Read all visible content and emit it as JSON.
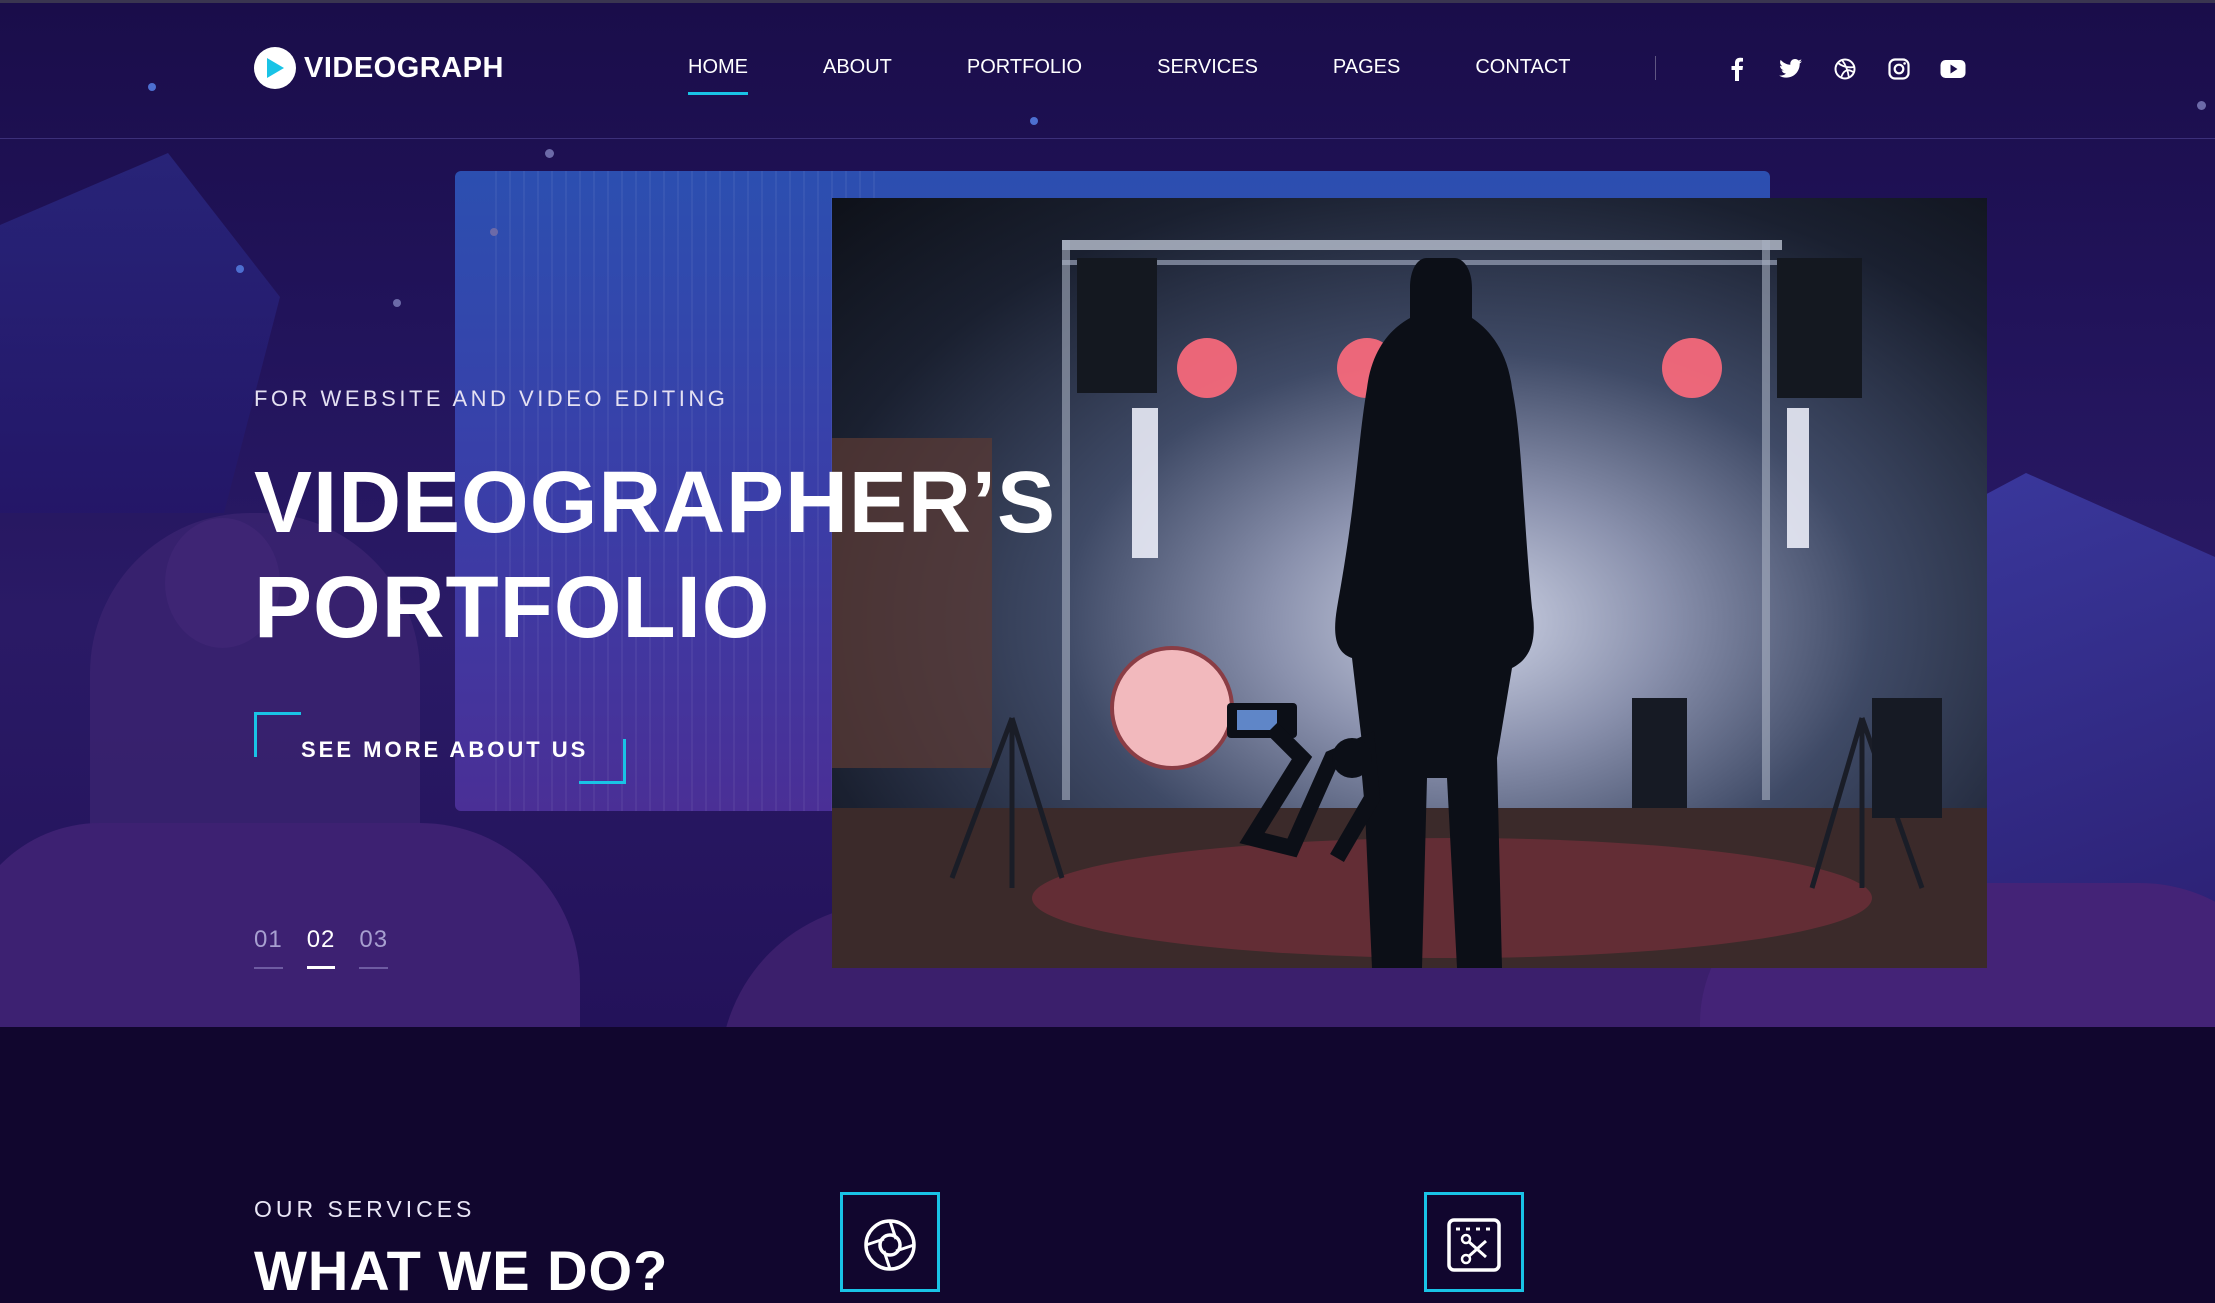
{
  "brand": {
    "name": "VIDEOGRAPH"
  },
  "nav": {
    "items": [
      {
        "label": "HOME",
        "active": true
      },
      {
        "label": "ABOUT"
      },
      {
        "label": "PORTFOLIO"
      },
      {
        "label": "SERVICES"
      },
      {
        "label": "PAGES"
      },
      {
        "label": "CONTACT"
      }
    ]
  },
  "social": [
    "facebook-icon",
    "twitter-icon",
    "dribbble-icon",
    "instagram-icon",
    "youtube-icon"
  ],
  "hero": {
    "eyebrow": "FOR WEBSITE AND VIDEO EDITING",
    "title_line1": "VIDEOGRAPHER’S",
    "title_line2": "PORTFOLIO",
    "cta": "SEE MORE ABOUT US",
    "slides": [
      "01",
      "02",
      "03"
    ],
    "active_slide": "02"
  },
  "services": {
    "label": "OUR SERVICES",
    "title": "WHAT WE DO?",
    "icons": [
      "camera-aperture-icon",
      "video-edit-icon"
    ]
  },
  "colors": {
    "accent": "#19c3e6",
    "background": "#11062e",
    "hero_bg": "#21135a"
  }
}
